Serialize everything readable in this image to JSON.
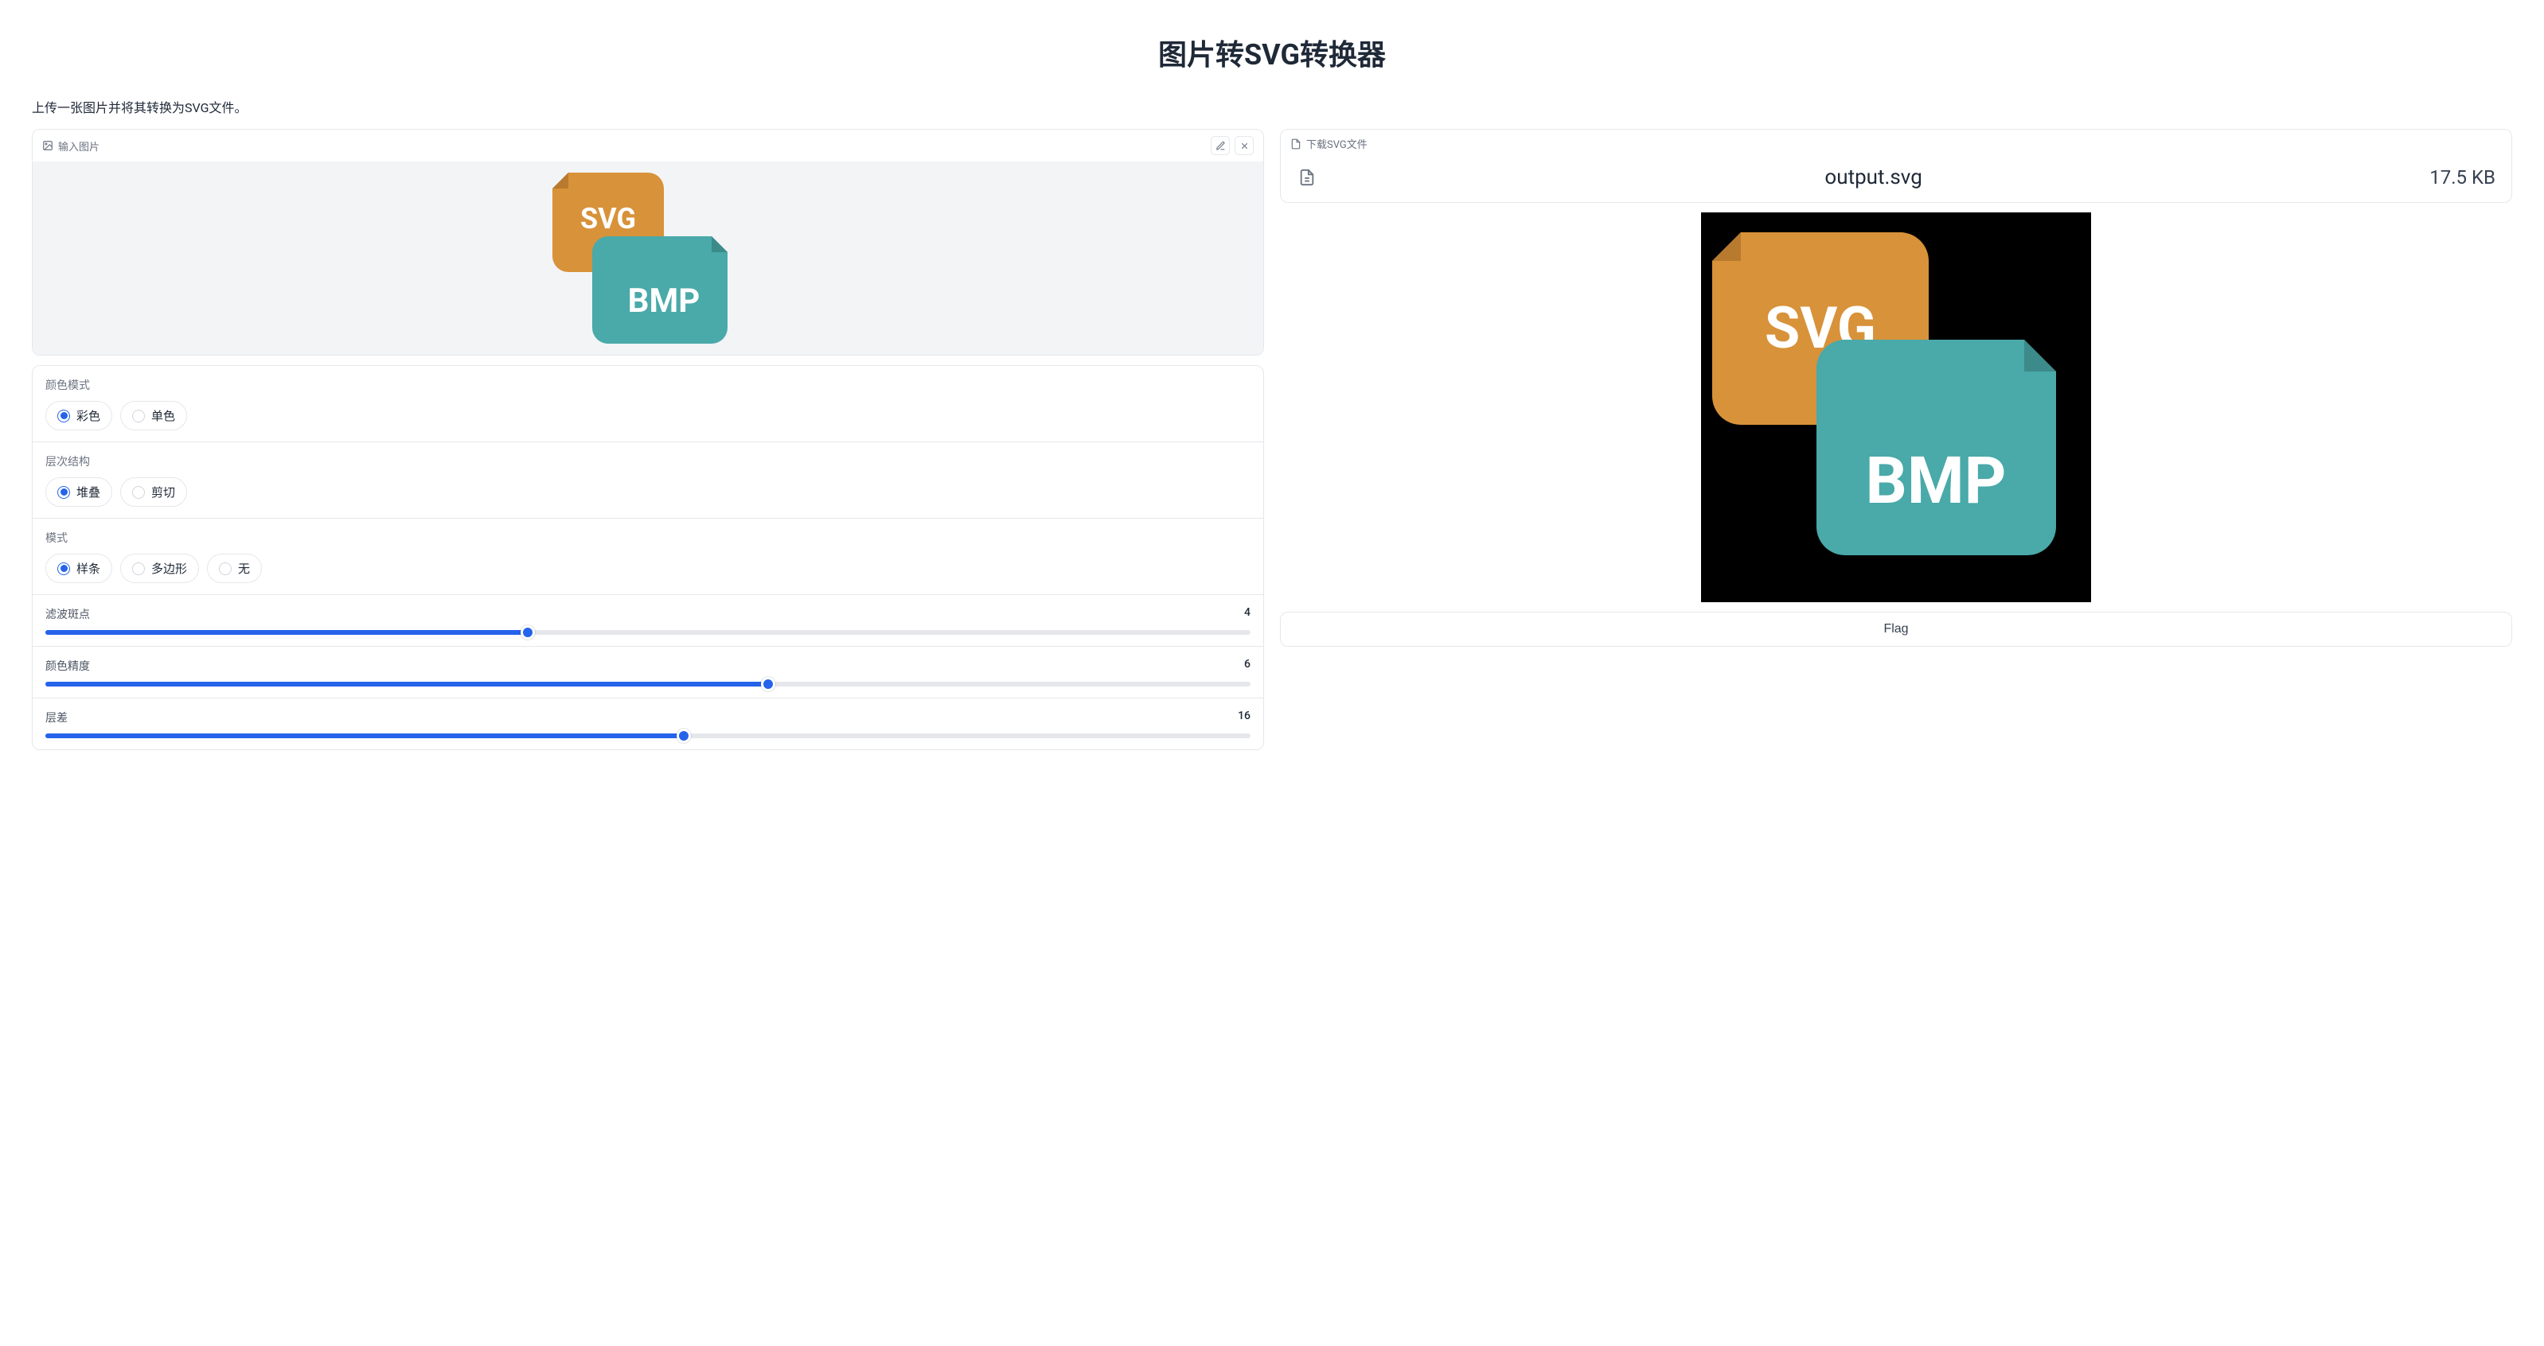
{
  "title": "图片转SVG转换器",
  "subtitle": "上传一张图片并将其转换为SVG文件。",
  "input": {
    "header": "输入图片",
    "preview_labels": {
      "svg": "SVG",
      "bmp": "BMP"
    }
  },
  "controls": {
    "color_mode": {
      "label": "颜色模式",
      "options": [
        "彩色",
        "单色"
      ],
      "selected": "彩色"
    },
    "hierarchy": {
      "label": "层次结构",
      "options": [
        "堆叠",
        "剪切"
      ],
      "selected": "堆叠"
    },
    "mode": {
      "label": "模式",
      "options": [
        "样条",
        "多边形",
        "无"
      ],
      "selected": "样条"
    },
    "sliders": {
      "filter_speckle": {
        "label": "滤波斑点",
        "value": 4,
        "max": 10
      },
      "color_precision": {
        "label": "颜色精度",
        "value": 6,
        "max": 10
      },
      "layer_difference": {
        "label": "层差",
        "value": 16,
        "max": 30
      }
    }
  },
  "output": {
    "header": "下载SVG文件",
    "filename": "output.svg",
    "filesize": "17.5 KB",
    "preview_labels": {
      "svg": "SVG",
      "bmp": "BMP"
    }
  },
  "flag_label": "Flag"
}
